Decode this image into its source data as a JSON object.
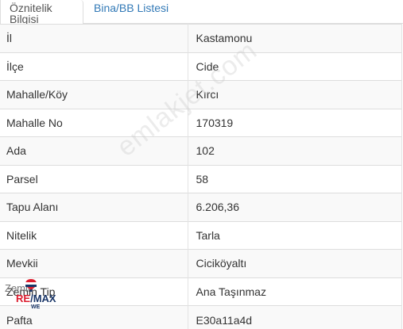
{
  "tabs": [
    {
      "label": "Öznitelik Bilgisi",
      "active": true
    },
    {
      "label": "Bina/BB Listesi",
      "active": false
    }
  ],
  "rows": [
    {
      "label": "İl",
      "value": "Kastamonu"
    },
    {
      "label": "İlçe",
      "value": "Cide"
    },
    {
      "label": "Mahalle/Köy",
      "value": "Kırcı"
    },
    {
      "label": "Mahalle No",
      "value": "170319"
    },
    {
      "label": "Ada",
      "value": "102"
    },
    {
      "label": "Parsel",
      "value": "58"
    },
    {
      "label": "Tapu Alanı",
      "value": "6.206,36"
    },
    {
      "label": "Nitelik",
      "value": "Tarla"
    },
    {
      "label": "Mevkii",
      "value": "Ciciköyaltı"
    },
    {
      "label": "Zemin Tip",
      "value": "Ana Taşınmaz"
    },
    {
      "label": "Pafta",
      "value": "E30a11a4d"
    }
  ],
  "watermark": {
    "site": "emlakjet.com"
  },
  "logo": {
    "top": "Zemin",
    "re": "RE",
    "slash": "/",
    "max": "MAX",
    "bottom": "WE"
  },
  "colors": {
    "link": "#337ab7",
    "stripe": "#f9f9f9",
    "border": "#dddddd",
    "remax_red": "#dc1c2e",
    "remax_blue": "#1a3668"
  }
}
